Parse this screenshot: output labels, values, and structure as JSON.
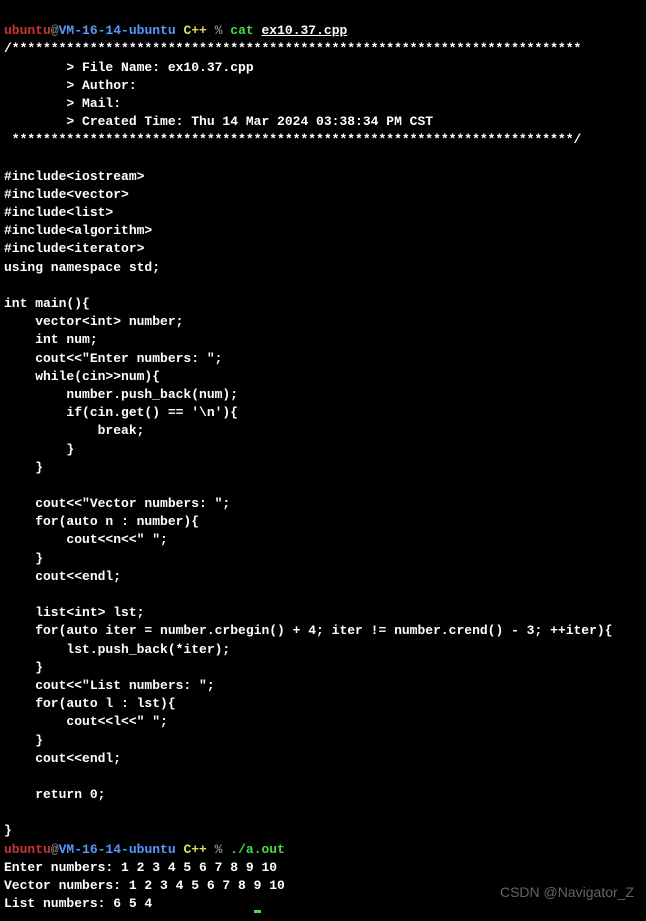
{
  "prompt1": {
    "user": "ubuntu",
    "at": "@",
    "host": "VM-16-14-ubuntu",
    "dir": " C++",
    "percent": " %",
    "cmd": " cat ",
    "file": "ex10.37.cpp"
  },
  "source": {
    "header_top": "/*************************************************************************",
    "file_line": "        > File Name: ex10.37.cpp",
    "author_line": "        > Author: ",
    "mail_line": "        > Mail: ",
    "time_line": "        > Created Time: Thu 14 Mar 2024 03:38:34 PM CST",
    "header_bot": " ************************************************************************/",
    "blank": "",
    "inc1": "#include<iostream>",
    "inc2": "#include<vector>",
    "inc3": "#include<list>",
    "inc4": "#include<algorithm>",
    "inc5": "#include<iterator>",
    "using": "using namespace std;",
    "main_sig": "int main(){",
    "vec_decl": "    vector<int> number;",
    "num_decl": "    int num;",
    "enter_prompt": "    cout<<\"Enter numbers: \";",
    "while_line": "    while(cin>>num){",
    "push_line": "        number.push_back(num);",
    "if_line": "        if(cin.get() == '\\n'){",
    "break_line": "            break;",
    "close_if": "        }",
    "close_while": "    }",
    "vec_cout": "    cout<<\"Vector numbers: \";",
    "for_n": "    for(auto n : number){",
    "cout_n": "        cout<<n<<\" \";",
    "close_for_n": "    }",
    "endl1": "    cout<<endl;",
    "list_decl": "    list<int> lst;",
    "for_iter": "    for(auto iter = number.crbegin() + 4; iter != number.crend() - 3; ++iter){",
    "lst_push": "        lst.push_back(*iter);",
    "close_for_iter": "    }",
    "list_cout": "    cout<<\"List numbers: \";",
    "for_l": "    for(auto l : lst){",
    "cout_l": "        cout<<l<<\" \";",
    "close_for_l": "    }",
    "endl2": "    cout<<endl;",
    "return": "    return 0;",
    "close_main": "}"
  },
  "prompt2": {
    "user": "ubuntu",
    "at": "@",
    "host": "VM-16-14-ubuntu",
    "dir": " C++",
    "percent": " %",
    "cmd": " ./a.out"
  },
  "run_output": {
    "enter": "Enter numbers: 1 2 3 4 5 6 7 8 9 10",
    "vector": "Vector numbers: 1 2 3 4 5 6 7 8 9 10 ",
    "list": "List numbers: 6 5 4 "
  },
  "watermark": "CSDN @Navigator_Z"
}
